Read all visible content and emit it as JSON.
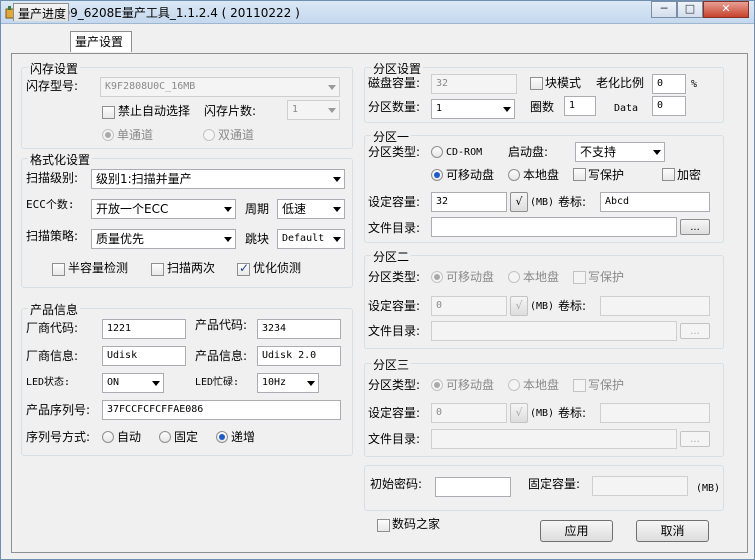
{
  "window": {
    "title": "MW8209_6208E量产工具_1.1.2.4 ( 20110222 )",
    "controls": {
      "minimize": "─",
      "maximize": "□",
      "close": "✕"
    }
  },
  "tabs": [
    {
      "label": "量产进度",
      "active": false
    },
    {
      "label": "量产设置",
      "active": true
    }
  ],
  "flash": {
    "title": "闪存设置",
    "model_label": "闪存型号:",
    "model_value": "K9F2808U0C_16MB",
    "disable_auto_label": "禁止自动选择",
    "count_label": "闪存片数:",
    "count_value": "1",
    "single_channel": "单通道",
    "dual_channel": "双通道"
  },
  "format": {
    "title": "格式化设置",
    "scan_level_label": "扫描级别:",
    "scan_level_value": "级别1:扫描并量产",
    "ecc_label": "ECC个数:",
    "ecc_value": "开放一个ECC",
    "period_label": "周期",
    "period_value": "低速",
    "strategy_label": "扫描策略:",
    "strategy_value": "质量优先",
    "skip_label": "跳块",
    "skip_value": "Default",
    "half_capacity": "半容量检测",
    "scan_twice": "扫描两次",
    "optimize": "优化侦测"
  },
  "product": {
    "title": "产品信息",
    "vendor_code_label": "厂商代码:",
    "vendor_code_value": "1221",
    "product_code_label": "产品代码:",
    "product_code_value": "3234",
    "vendor_info_label": "厂商信息:",
    "vendor_info_value": "Udisk",
    "product_info_label": "产品信息:",
    "product_info_value": "Udisk 2.0",
    "led_status_label": "LED状态:",
    "led_status_value": "ON",
    "led_busy_label": "LED忙碌:",
    "led_busy_value": "10Hz",
    "serial_label": "产品序列号:",
    "serial_value": "37FCCFCFCFFAE086",
    "serial_mode_label": "序列号方式:",
    "mode_auto": "自动",
    "mode_fixed": "固定",
    "mode_increment": "递增"
  },
  "partition": {
    "title": "分区设置",
    "disk_capacity_label": "磁盘容量:",
    "disk_capacity_value": "32",
    "block_mode_label": "块模式",
    "aging_label": "老化比例",
    "aging_value": "0",
    "aging_unit": "%",
    "count_label": "分区数量:",
    "count_value": "1",
    "laps_label": "圈数",
    "laps_value": "1",
    "data_label": "Data",
    "data_value": "0"
  },
  "part1": {
    "title": "分区一",
    "type_label": "分区类型:",
    "cdrom": "CD-ROM",
    "boot_label": "启动盘:",
    "boot_value": "不支持",
    "removable": "可移动盘",
    "local": "本地盘",
    "write_protect": "写保护",
    "encrypt": "加密",
    "capacity_label": "设定容量:",
    "capacity_value": "32",
    "unit_label": "(MB)",
    "volume_label": "卷标:",
    "volume_value": "Abcd",
    "dir_label": "文件目录:",
    "browse": "..."
  },
  "part2": {
    "title": "分区二",
    "type_label": "分区类型:",
    "removable": "可移动盘",
    "local": "本地盘",
    "write_protect": "写保护",
    "capacity_label": "设定容量:",
    "capacity_value": "0",
    "unit_label": "(MB)",
    "volume_label": "卷标:",
    "dir_label": "文件目录:",
    "browse": "..."
  },
  "part3": {
    "title": "分区三",
    "type_label": "分区类型:",
    "removable": "可移动盘",
    "local": "本地盘",
    "write_protect": "写保护",
    "capacity_label": "设定容量:",
    "capacity_value": "0",
    "unit_label": "(MB)",
    "volume_label": "卷标:",
    "dir_label": "文件目录:",
    "browse": "..."
  },
  "password": {
    "initial_label": "初始密码:",
    "fixed_capacity_label": "固定容量:",
    "unit_label": "(MB)"
  },
  "footer": {
    "watermark_checkbox": "数码之家",
    "apply": "应用",
    "cancel": "取消"
  }
}
